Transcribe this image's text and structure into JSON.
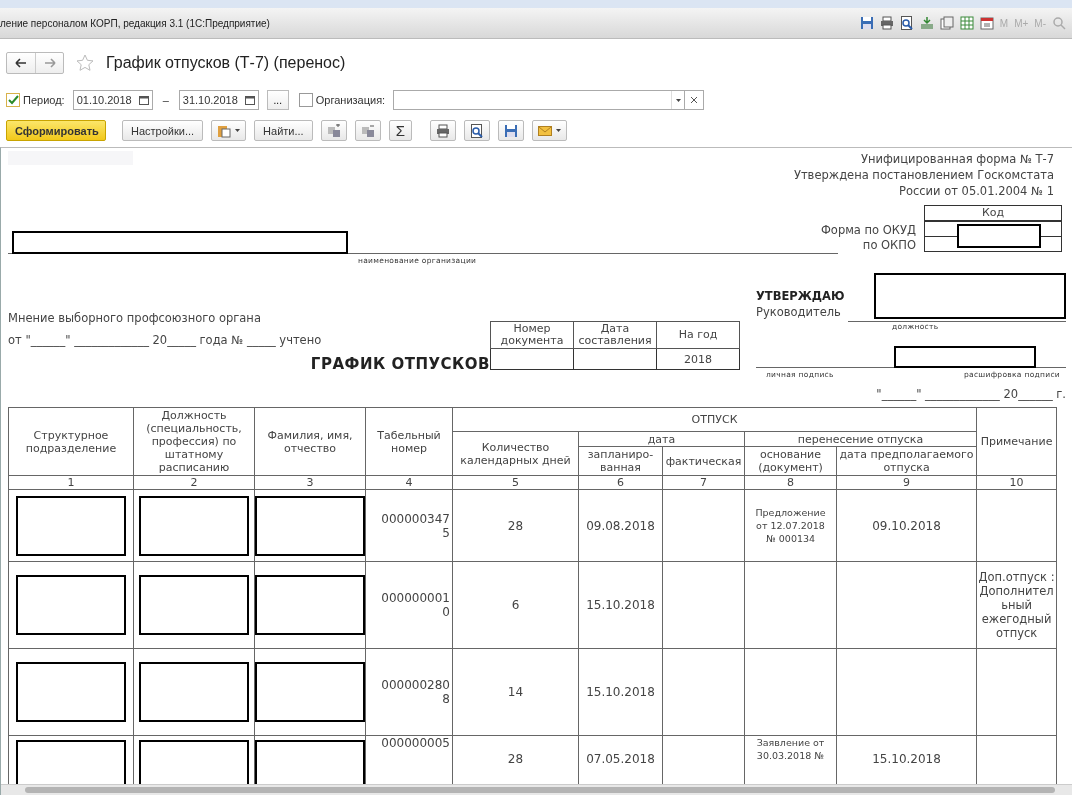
{
  "window": {
    "title": "ление персоналом КОРП, редакция 3.1  (1С:Предприятие)",
    "memory_keys": [
      "M",
      "M+",
      "M-"
    ]
  },
  "header": {
    "title": "График отпусков (Т-7) (перенос)",
    "favorite": false
  },
  "filters": {
    "period_checked": true,
    "period_label": "Период:",
    "from": "01.10.2018",
    "dash": "–",
    "to": "31.10.2018",
    "more": "...",
    "org_checked": false,
    "org_label": "Организация:"
  },
  "toolbar": {
    "generate": "Сформировать",
    "settings": "Настройки...",
    "find": "Найти...",
    "sum": "Σ"
  },
  "form": {
    "header_lines": [
      "Унифицированная форма № Т-7",
      "Утверждена постановлением Госкомстата",
      "России от 05.01.2004 № 1"
    ],
    "code_header": "Код",
    "code_labels": [
      "Форма по ОКУД",
      "по ОКПО"
    ],
    "org_redacted": true,
    "org_caption": "наименование организации",
    "union_lines": [
      "Мнение выборного профсоюзного органа",
      "от \"______\" _____________ 20_____ года № _____ учтено"
    ],
    "title": "ГРАФИК ОТПУСКОВ",
    "doc_table": {
      "columns": [
        "Номер документа",
        "Дата составления",
        "На год"
      ],
      "year": "2018"
    },
    "approve": {
      "heading": "УТВЕРЖДАЮ",
      "role": "Руководитель",
      "role_redacted": true,
      "role_caption": "должность",
      "signature_caption": "личная подпись",
      "name_redacted": true,
      "name_caption": "расшифровка подписи",
      "date_line": "\"______\" _____________ 20______ г."
    }
  },
  "table": {
    "columns": [
      "Структурное подразделение",
      "Должность (специальность, профессия) по штатному расписанию",
      "Фамилия, имя, отчество",
      "Табельный номер",
      "Количество календарных дней"
    ],
    "group": "ОТПУСК",
    "date_group": "дата",
    "date_columns": [
      "запланиро-ванная",
      "фактическая"
    ],
    "transfer_group": "перенесение отпуска",
    "transfer_columns": [
      "основание (документ)",
      "дата предполагаемого отпуска"
    ],
    "note_column": "Примечание",
    "numbers": [
      "1",
      "2",
      "3",
      "4",
      "5",
      "6",
      "7",
      "8",
      "9",
      "10"
    ],
    "rows": [
      {
        "redacted": true,
        "tab_number": "0000003475",
        "days": "28",
        "planned": "09.08.2018",
        "basis": "Предложение от 12.07.2018 № 000134",
        "proposed": "09.10.2018"
      },
      {
        "redacted": true,
        "tab_number": "0000000010",
        "days": "6",
        "planned": "15.10.2018",
        "note": "Доп.отпуск : Дополнительный ежегодный отпуск"
      },
      {
        "redacted": true,
        "tab_number": "0000002808",
        "days": "14",
        "planned": "15.10.2018"
      },
      {
        "redacted": true,
        "tab_number": "000000005",
        "days": "28",
        "planned": "07.05.2018",
        "basis": "Заявление от 30.03.2018 №",
        "proposed": "15.10.2018"
      }
    ]
  }
}
